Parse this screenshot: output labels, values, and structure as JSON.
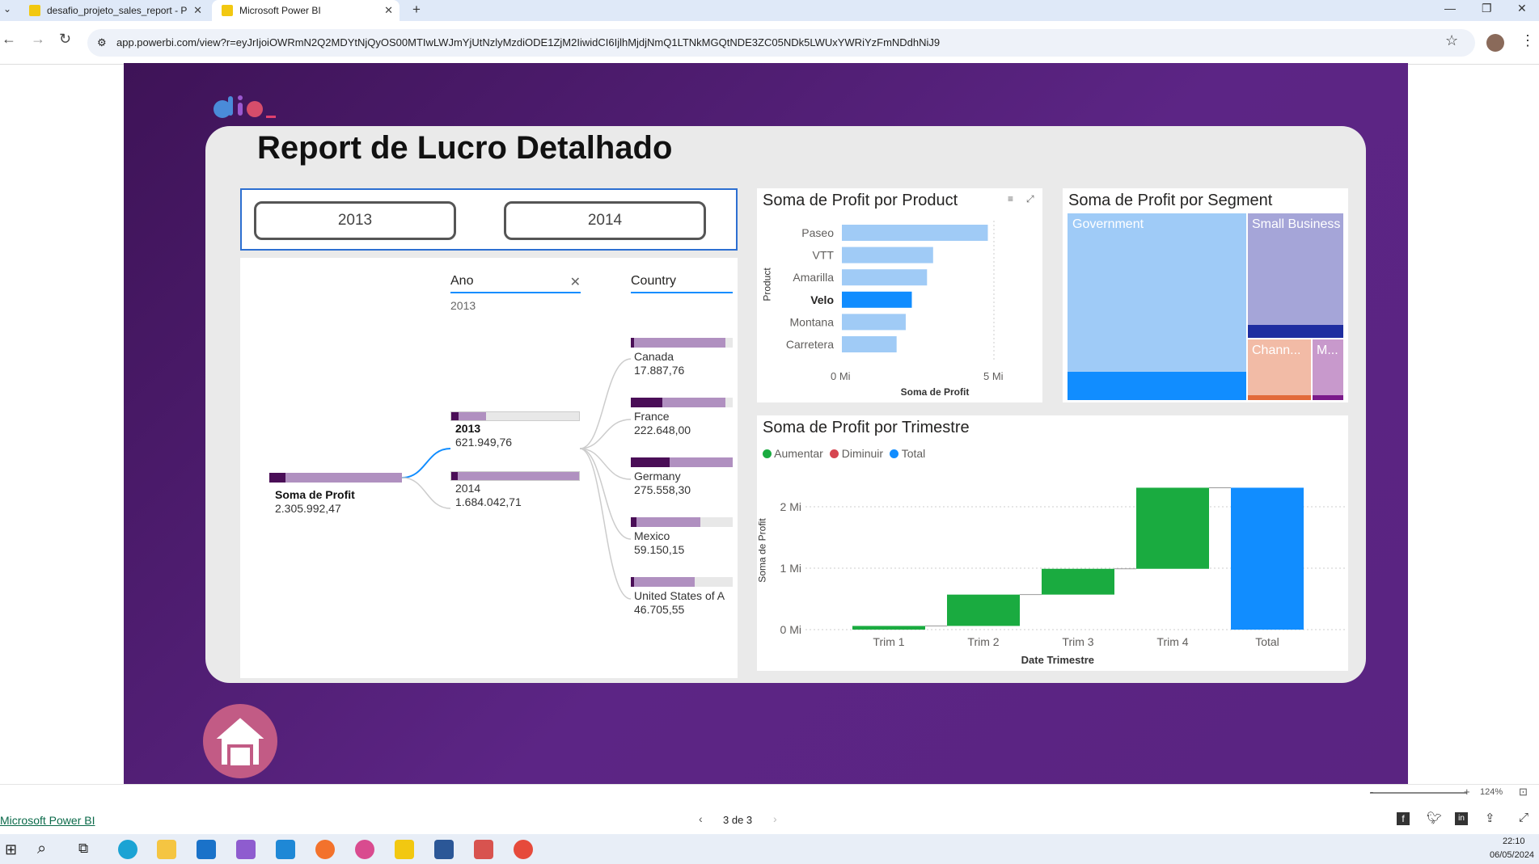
{
  "browser": {
    "tabs": [
      {
        "title": "desafio_projeto_sales_report - P"
      },
      {
        "title": "Microsoft Power BI"
      }
    ],
    "url": "app.powerbi.com/view?r=eyJrIjoiOWRmN2Q2MDYtNjQyOS00MTIwLWJmYjUtNzlyMzdiODE1ZjM2IiwidCI6IjlhMjdjNmQ1LTNkMGQtNDE3ZC05NDk5LWUxYWRiYzFmNDdhNiJ9"
  },
  "report": {
    "title": "Report de Lucro Detalhado",
    "slicer": {
      "options": [
        "2013",
        "2014"
      ]
    },
    "decomp_tree": {
      "headers": {
        "level1": "Ano",
        "level1_filter": "2013",
        "level2": "Country"
      },
      "root": {
        "label": "Soma de Profit",
        "value": "2.305.992,47"
      },
      "years": [
        {
          "label": "2013",
          "value": "621.949,76",
          "fraction": 0.27
        },
        {
          "label": "2014",
          "value": "1.684.042,71",
          "fraction": 0.73
        }
      ],
      "countries": [
        {
          "label": "Canada",
          "value": "17.887,76",
          "fraction": 0.93
        },
        {
          "label": "France",
          "value": "222.648,00",
          "fraction": 0.93
        },
        {
          "label": "Germany",
          "value": "275.558,30",
          "fraction": 1.0
        },
        {
          "label": "Mexico",
          "value": "59.150,15",
          "fraction": 0.68
        },
        {
          "label": "United States of A",
          "value": "46.705,55",
          "fraction": 0.63
        }
      ]
    },
    "product_chart": {
      "title": "Soma de Profit por Product",
      "xlabel": "Soma de Profit",
      "ylabel": "Product",
      "xticks": [
        "0 Mi",
        "5 Mi"
      ]
    },
    "segment_chart": {
      "title": "Soma de Profit por Segment",
      "labels": [
        "Government",
        "Small Business",
        "Chann...",
        "M..."
      ]
    },
    "waterfall_chart": {
      "title": "Soma de Profit por Trimestre",
      "legend": [
        {
          "label": "Aumentar",
          "color": "#1aab40"
        },
        {
          "label": "Diminuir",
          "color": "#d64550"
        },
        {
          "label": "Total",
          "color": "#118dff"
        }
      ],
      "xlabel": "Date Trimestre",
      "ylabel": "Soma de Profit",
      "yticks": [
        "0 Mi",
        "1 Mi",
        "2 Mi"
      ]
    },
    "page_nav": "3 de 3",
    "zoom": "124%"
  },
  "footer": {
    "link": "Microsoft Power BI"
  },
  "taskbar": {
    "time": "22:10",
    "date": "06/05/2024"
  },
  "chart_data": [
    {
      "type": "bar",
      "title": "Soma de Profit por Product",
      "categories": [
        "Paseo",
        "VTT",
        "Amarilla",
        "Velo",
        "Montana",
        "Carretera"
      ],
      "values": [
        4.8,
        3.0,
        2.8,
        2.3,
        2.1,
        1.8
      ],
      "highlighted": "Velo",
      "xlim": [
        0,
        5.5
      ],
      "xlabel": "Soma de Profit",
      "ylabel": "Product"
    },
    {
      "type": "treemap",
      "title": "Soma de Profit por Segment",
      "categories": [
        "Government",
        "Small Business",
        "Chann...",
        "M..."
      ],
      "values": [
        11.4,
        4.1,
        1.3,
        0.6
      ]
    },
    {
      "type": "waterfall",
      "title": "Soma de Profit por Trimestre",
      "categories": [
        "Trim 1",
        "Trim 2",
        "Trim 3",
        "Trim 4",
        "Total"
      ],
      "values": [
        0.06,
        0.51,
        0.42,
        1.32,
        2.31
      ],
      "kinds": [
        "Aumentar",
        "Aumentar",
        "Aumentar",
        "Aumentar",
        "Total"
      ],
      "ylim": [
        0,
        2.3
      ],
      "xlabel": "Date Trimestre",
      "ylabel": "Soma de Profit"
    }
  ]
}
